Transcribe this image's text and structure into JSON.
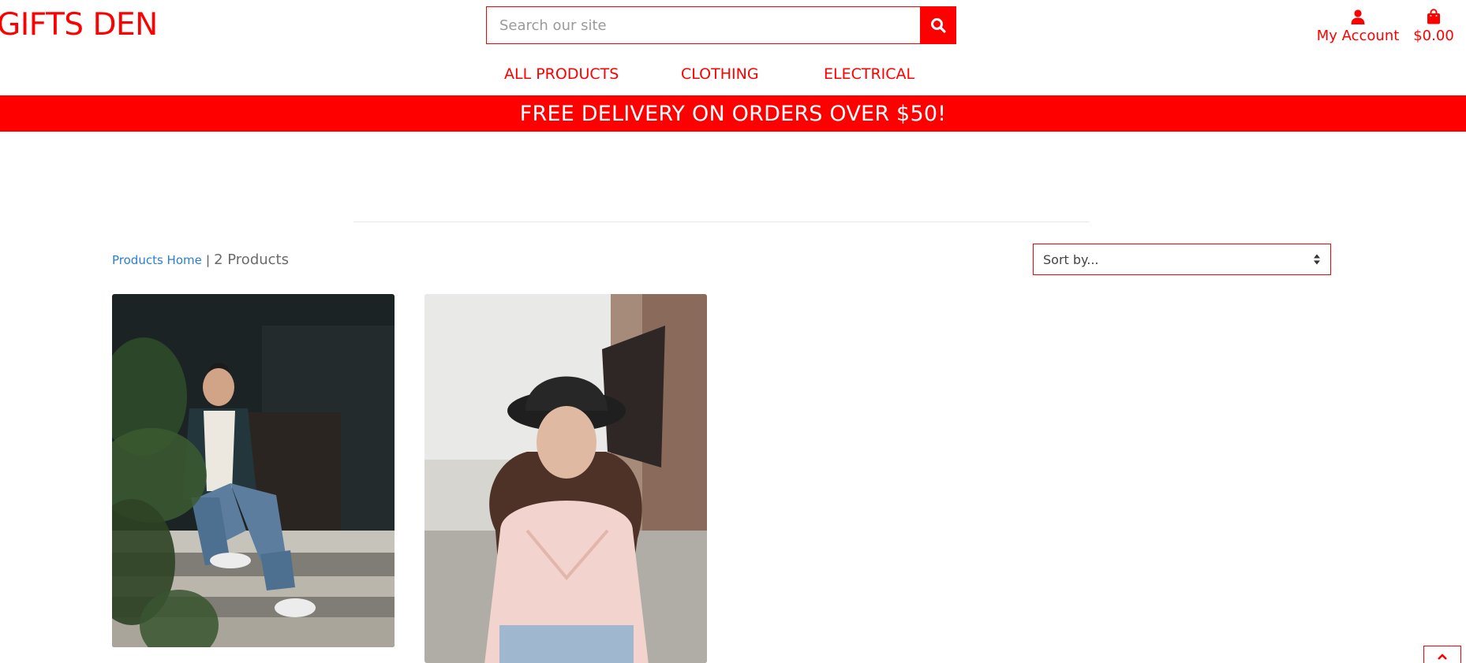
{
  "header": {
    "logo": "GIFTS DEN",
    "search": {
      "placeholder": "Search our site"
    },
    "account_label": "My Account",
    "cart_total": "$0.00"
  },
  "nav": {
    "items": [
      {
        "label": "ALL PRODUCTS"
      },
      {
        "label": "CLOTHING"
      },
      {
        "label": "ELECTRICAL"
      }
    ]
  },
  "banner": {
    "text": "FREE DELIVERY ON ORDERS OVER $50!"
  },
  "products": {
    "breadcrumb_link": "Products Home",
    "separator": "|",
    "count_text": "2 Products",
    "sort_label": "Sort by..."
  },
  "colors": {
    "accent": "#ff0000",
    "link": "#2a7fd4"
  },
  "icons": {
    "search": "search-icon",
    "account": "user-icon",
    "cart": "shopping-bag-icon",
    "sort": "sort-arrows-icon",
    "scroll_top": "chevron-up-icon"
  }
}
